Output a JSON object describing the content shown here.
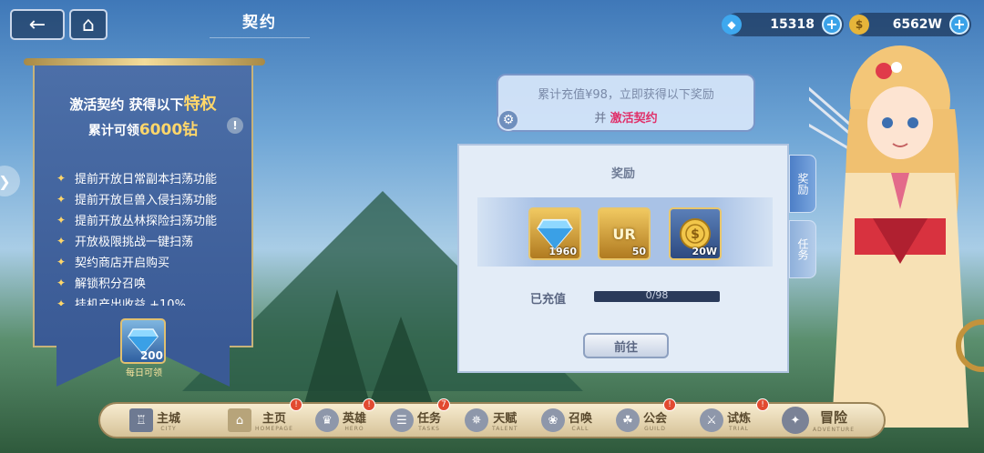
{
  "header": {
    "back_icon": "back-arrow-icon",
    "home_icon": "home-icon",
    "title": "契约",
    "currencies": [
      {
        "icon": "diamond-icon",
        "value": "15318"
      },
      {
        "icon": "gold-coin-icon",
        "value": "6562W"
      }
    ]
  },
  "banner": {
    "line1_prefix": "激活契约 获得以下",
    "line1_highlight": "特权",
    "line2_prefix": "累计可领",
    "line2_highlight": "6000钻",
    "perks": [
      "提前开放日常副本扫荡功能",
      "提前开放巨兽入侵扫荡功能",
      "提前开放丛林探险扫荡功能",
      "开放极限挑战一键扫荡",
      "契约商店开启购买",
      "解锁积分召唤",
      "挂机产出收益 +10%"
    ],
    "daily_reward": {
      "icon": "diamond-icon",
      "count": "200",
      "label": "每日可领"
    }
  },
  "notice": {
    "line1": "累计充值¥98，立即获得以下奖励",
    "line2_prefix": "并",
    "line2_highlight": "激活契约"
  },
  "reward_panel": {
    "title": "奖励",
    "items": [
      {
        "icon": "diamond-icon",
        "count": "1960"
      },
      {
        "icon": "ur-fragment-icon",
        "badge": "UR",
        "count": "50"
      },
      {
        "icon": "gold-coin-icon",
        "count": "20W"
      }
    ],
    "charged_label": "已充值",
    "progress_text": "0/98",
    "progress_fraction": 0,
    "goto_label": "前往"
  },
  "side_tabs": [
    "奖励",
    "任务"
  ],
  "nav": [
    {
      "label": "主城",
      "sub": "CITY",
      "badge": ""
    },
    {
      "label": "主页",
      "sub": "HOMEPAGE",
      "badge": "!"
    },
    {
      "label": "英雄",
      "sub": "HERO",
      "badge": "!"
    },
    {
      "label": "任务",
      "sub": "TASKS",
      "badge": "7"
    },
    {
      "label": "天赋",
      "sub": "TALENT",
      "badge": ""
    },
    {
      "label": "召唤",
      "sub": "CALL",
      "badge": ""
    },
    {
      "label": "公会",
      "sub": "GUILD",
      "badge": "!"
    },
    {
      "label": "试炼",
      "sub": "TRIAL",
      "badge": "!"
    },
    {
      "label": "冒险",
      "sub": "ADVENTURE",
      "badge": ""
    }
  ],
  "colors": {
    "gold": "#ffd76a",
    "highlight_red": "#e0306a",
    "accent_blue": "#3aa2e8"
  }
}
